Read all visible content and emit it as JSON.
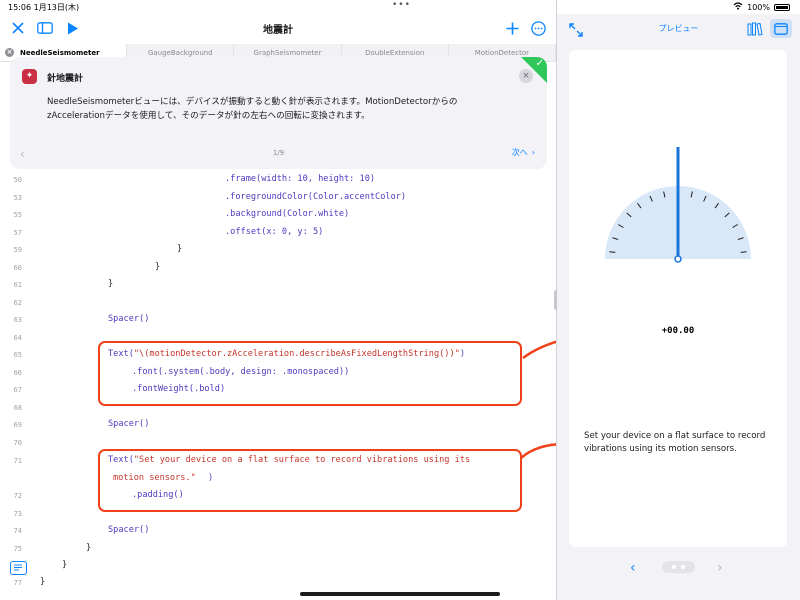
{
  "status_bar": {
    "time": "15:06",
    "date": "1月13日(木)",
    "battery": "100%"
  },
  "editor": {
    "title": "地震計",
    "tabs": [
      "NeedleSeismometer",
      "GaugeBackground",
      "GraphSeismometer",
      "DoubleExtension",
      "MotionDetector"
    ],
    "icons": {
      "close": "close-icon",
      "sidebar": "sidebar-icon",
      "run": "play-icon",
      "add": "plus-icon",
      "more": "ellipsis-icon"
    }
  },
  "guide": {
    "title": "針地震計",
    "body_line1": "NeedleSeismometerビューには、デバイスが振動すると動く針が表示されます。MotionDetectorからの",
    "body_line2": "zAccelerationデータを使用して、そのデータが針の左右への回転に変換されます。",
    "page": "1/9",
    "next_label": "次へ"
  },
  "code": {
    "ln50": "50",
    "ln53": "53",
    "ln55": "55",
    "ln57": "57",
    "ln59": "59",
    "ln60": "60",
    "ln61": "61",
    "ln62": "62",
    "ln63": "63",
    "ln64": "64",
    "ln65": "65",
    "ln66": "66",
    "ln67": "67",
    "ln68": "68",
    "ln69": "69",
    "ln70": "70",
    "ln71": "71",
    "ln72": "72",
    "ln73": "73",
    "ln74": "74",
    "ln75": "75",
    "ln76": "76",
    "ln77": "77",
    "frame": ".frame(width: 10, height: 10)",
    "fg": ".foregroundColor(Color.accentColor)",
    "bg": ".background(Color.white)",
    "offset": ".offset(x: 0, y: 5)",
    "brace": "}",
    "spacer": "Spacer()",
    "text1_open": "Text(",
    "text1_str": "\"\\(motionDetector.zAcceleration.describeAsFixedLengthString())\"",
    "text1_close": ")",
    "font": ".font(.system(.body, design: .monospaced))",
    "weight": ".fontWeight(.bold)",
    "text2_open": "Text(",
    "text2_str1": "\"Set your device on a flat surface to record vibrations using its",
    "text2_str2": "motion sensors.\"",
    "text2_close": ")",
    "padding": ".padding()"
  },
  "preview": {
    "title": "プレビュー",
    "readout": "+00.00",
    "needle_reading": 0.0,
    "message": "Set your device on a flat surface to record vibrations using its motion sensors.",
    "accent": "#1a73d9"
  }
}
